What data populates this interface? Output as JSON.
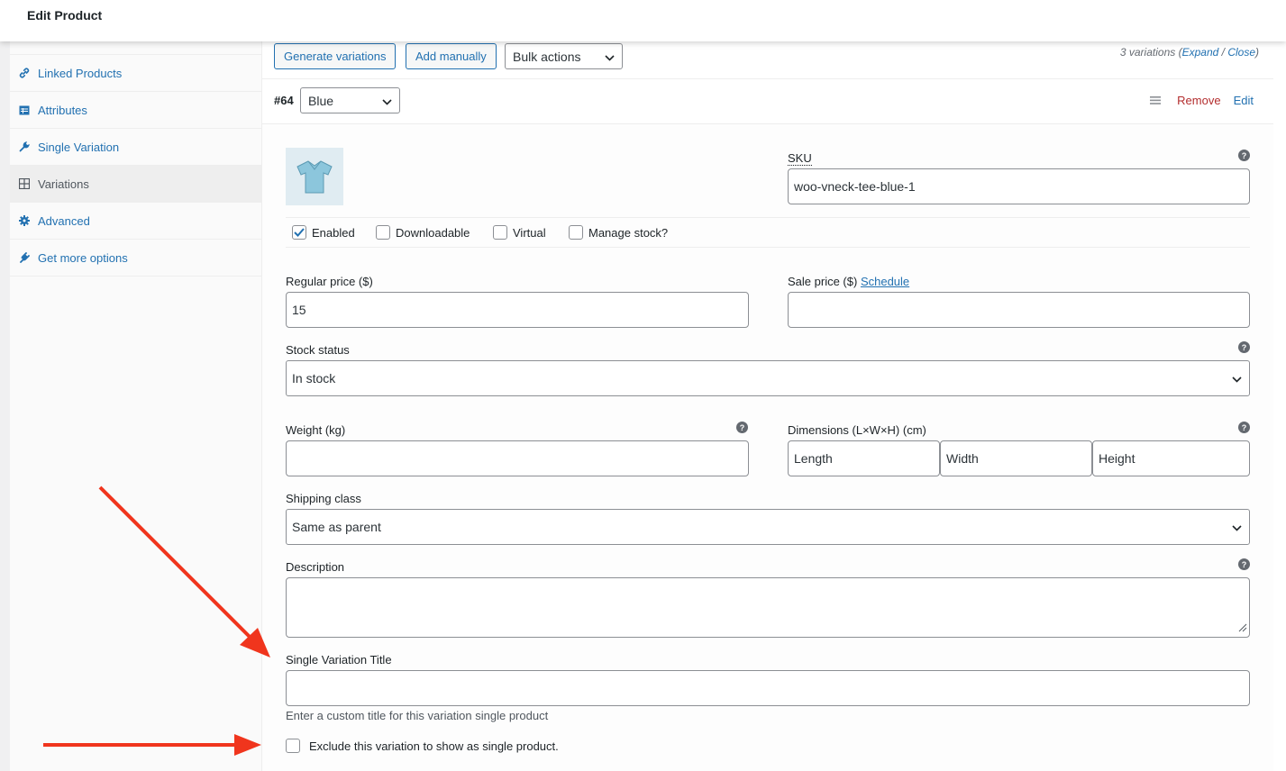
{
  "header": {
    "title": "Edit Product"
  },
  "sidebar": {
    "items": [
      {
        "label": "Linked Products",
        "icon": "link-icon"
      },
      {
        "label": "Attributes",
        "icon": "table-icon"
      },
      {
        "label": "Single Variation",
        "icon": "wrench-icon"
      },
      {
        "label": "Variations",
        "icon": "grid-icon",
        "active": true
      },
      {
        "label": "Advanced",
        "icon": "gear-icon"
      },
      {
        "label": "Get more options",
        "icon": "plugin-icon"
      }
    ]
  },
  "toolbar": {
    "generate_label": "Generate variations",
    "add_manually_label": "Add manually",
    "bulk_actions_value": "Bulk actions",
    "count_text": "3 variations",
    "expand_label": "Expand",
    "close_label": "Close"
  },
  "variation": {
    "number": "#64",
    "attribute_value": "Blue",
    "remove_label": "Remove",
    "edit_label": "Edit",
    "sku_label": "SKU",
    "sku_value": "woo-vneck-tee-blue-1",
    "checkboxes": [
      {
        "label": "Enabled",
        "checked": true
      },
      {
        "label": "Downloadable",
        "checked": false
      },
      {
        "label": "Virtual",
        "checked": false
      },
      {
        "label": "Manage stock?",
        "checked": false
      }
    ],
    "regular_price_label": "Regular price ($)",
    "regular_price_value": "15",
    "sale_price_label": "Sale price ($)",
    "schedule_label": "Schedule",
    "sale_price_value": "",
    "stock_status_label": "Stock status",
    "stock_status_value": "In stock",
    "weight_label": "Weight (kg)",
    "weight_value": "",
    "dimensions_label": "Dimensions (L×W×H) (cm)",
    "length_placeholder": "Length",
    "width_placeholder": "Width",
    "height_placeholder": "Height",
    "shipping_class_label": "Shipping class",
    "shipping_class_value": "Same as parent",
    "description_label": "Description",
    "description_value": "",
    "single_title_label": "Single Variation Title",
    "single_title_value": "",
    "single_title_hint": "Enter a custom title for this variation single product",
    "exclude_label": "Exclude this variation to show as single product."
  },
  "colors": {
    "link": "#2271b1",
    "remove": "#b32d2e",
    "annotation_arrow": "#f0351d"
  }
}
